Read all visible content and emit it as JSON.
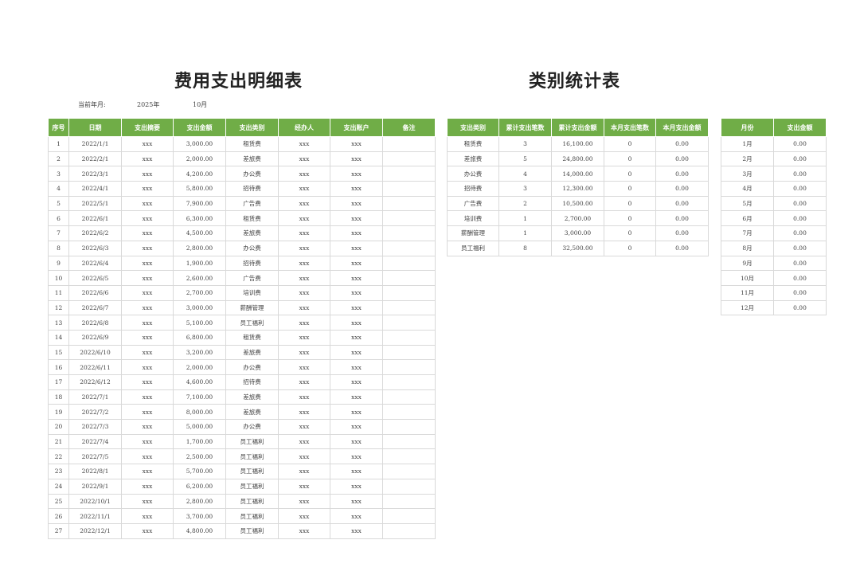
{
  "detail": {
    "title": "费用支出明细表",
    "period_label": "当前年月:",
    "year": "2025年",
    "month": "10月",
    "headers": [
      "序号",
      "日期",
      "支出摘要",
      "支出金额",
      "支出类别",
      "经办人",
      "支出账户",
      "备注"
    ],
    "rows": [
      [
        "1",
        "2022/1/1",
        "xxx",
        "3,000.00",
        "租赁费",
        "xxx",
        "xxx",
        ""
      ],
      [
        "2",
        "2022/2/1",
        "xxx",
        "2,000.00",
        "差旅费",
        "xxx",
        "xxx",
        ""
      ],
      [
        "3",
        "2022/3/1",
        "xxx",
        "4,200.00",
        "办公费",
        "xxx",
        "xxx",
        ""
      ],
      [
        "4",
        "2022/4/1",
        "xxx",
        "5,800.00",
        "招待费",
        "xxx",
        "xxx",
        ""
      ],
      [
        "5",
        "2022/5/1",
        "xxx",
        "7,900.00",
        "广告费",
        "xxx",
        "xxx",
        ""
      ],
      [
        "6",
        "2022/6/1",
        "xxx",
        "6,300.00",
        "租赁费",
        "xxx",
        "xxx",
        ""
      ],
      [
        "7",
        "2022/6/2",
        "xxx",
        "4,500.00",
        "差旅费",
        "xxx",
        "xxx",
        ""
      ],
      [
        "8",
        "2022/6/3",
        "xxx",
        "2,800.00",
        "办公费",
        "xxx",
        "xxx",
        ""
      ],
      [
        "9",
        "2022/6/4",
        "xxx",
        "1,900.00",
        "招待费",
        "xxx",
        "xxx",
        ""
      ],
      [
        "10",
        "2022/6/5",
        "xxx",
        "2,600.00",
        "广告费",
        "xxx",
        "xxx",
        ""
      ],
      [
        "11",
        "2022/6/6",
        "xxx",
        "2,700.00",
        "培训费",
        "xxx",
        "xxx",
        ""
      ],
      [
        "12",
        "2022/6/7",
        "xxx",
        "3,000.00",
        "薪酬管理",
        "xxx",
        "xxx",
        ""
      ],
      [
        "13",
        "2022/6/8",
        "xxx",
        "5,100.00",
        "员工福利",
        "xxx",
        "xxx",
        ""
      ],
      [
        "14",
        "2022/6/9",
        "xxx",
        "6,800.00",
        "租赁费",
        "xxx",
        "xxx",
        ""
      ],
      [
        "15",
        "2022/6/10",
        "xxx",
        "3,200.00",
        "差旅费",
        "xxx",
        "xxx",
        ""
      ],
      [
        "16",
        "2022/6/11",
        "xxx",
        "2,000.00",
        "办公费",
        "xxx",
        "xxx",
        ""
      ],
      [
        "17",
        "2022/6/12",
        "xxx",
        "4,600.00",
        "招待费",
        "xxx",
        "xxx",
        ""
      ],
      [
        "18",
        "2022/7/1",
        "xxx",
        "7,100.00",
        "差旅费",
        "xxx",
        "xxx",
        ""
      ],
      [
        "19",
        "2022/7/2",
        "xxx",
        "8,000.00",
        "差旅费",
        "xxx",
        "xxx",
        ""
      ],
      [
        "20",
        "2022/7/3",
        "xxx",
        "5,000.00",
        "办公费",
        "xxx",
        "xxx",
        ""
      ],
      [
        "21",
        "2022/7/4",
        "xxx",
        "1,700.00",
        "员工福利",
        "xxx",
        "xxx",
        ""
      ],
      [
        "22",
        "2022/7/5",
        "xxx",
        "2,500.00",
        "员工福利",
        "xxx",
        "xxx",
        ""
      ],
      [
        "23",
        "2022/8/1",
        "xxx",
        "5,700.00",
        "员工福利",
        "xxx",
        "xxx",
        ""
      ],
      [
        "24",
        "2022/9/1",
        "xxx",
        "6,200.00",
        "员工福利",
        "xxx",
        "xxx",
        ""
      ],
      [
        "25",
        "2022/10/1",
        "xxx",
        "2,800.00",
        "员工福利",
        "xxx",
        "xxx",
        ""
      ],
      [
        "26",
        "2022/11/1",
        "xxx",
        "3,700.00",
        "员工福利",
        "xxx",
        "xxx",
        ""
      ],
      [
        "27",
        "2022/12/1",
        "xxx",
        "4,800.00",
        "员工福利",
        "xxx",
        "xxx",
        ""
      ]
    ]
  },
  "category": {
    "title": "类别统计表",
    "headers": [
      "支出类别",
      "累计支出笔数",
      "累计支出金额",
      "本月支出笔数",
      "本月支出金额"
    ],
    "rows": [
      [
        "租赁费",
        "3",
        "16,100.00",
        "0",
        "0.00"
      ],
      [
        "差旅费",
        "5",
        "24,800.00",
        "0",
        "0.00"
      ],
      [
        "办公费",
        "4",
        "14,000.00",
        "0",
        "0.00"
      ],
      [
        "招待费",
        "3",
        "12,300.00",
        "0",
        "0.00"
      ],
      [
        "广告费",
        "2",
        "10,500.00",
        "0",
        "0.00"
      ],
      [
        "培训费",
        "1",
        "2,700.00",
        "0",
        "0.00"
      ],
      [
        "薪酬管理",
        "1",
        "3,000.00",
        "0",
        "0.00"
      ],
      [
        "员工福利",
        "8",
        "32,500.00",
        "0",
        "0.00"
      ]
    ]
  },
  "monthly": {
    "headers": [
      "月份",
      "支出金额"
    ],
    "rows": [
      [
        "1月",
        "0.00"
      ],
      [
        "2月",
        "0.00"
      ],
      [
        "3月",
        "0.00"
      ],
      [
        "4月",
        "0.00"
      ],
      [
        "5月",
        "0.00"
      ],
      [
        "6月",
        "0.00"
      ],
      [
        "7月",
        "0.00"
      ],
      [
        "8月",
        "0.00"
      ],
      [
        "9月",
        "0.00"
      ],
      [
        "10月",
        "0.00"
      ],
      [
        "11月",
        "0.00"
      ],
      [
        "12月",
        "0.00"
      ]
    ]
  },
  "colors": {
    "header_bg": "#70ad47",
    "header_text": "#ffffff",
    "grid": "#d9d9d9"
  }
}
